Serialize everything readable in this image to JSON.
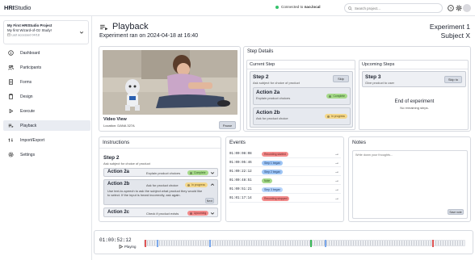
{
  "app": {
    "logo_bold": "HRI",
    "logo_rest": "Studio"
  },
  "topbar": {
    "connection_prefix": "Connected to ",
    "connection_host": "nao.local",
    "search_placeholder": "Search project...",
    "status_color": "#34c26b"
  },
  "project": {
    "name": "My First HRIStudio Project",
    "study": "My first Wizard-of-Oz Study!",
    "accessed": "Last accessed 04/18"
  },
  "sidebar": {
    "items": [
      {
        "label": "Dashboard",
        "icon": "info-icon"
      },
      {
        "label": "Participants",
        "icon": "users-icon"
      },
      {
        "label": "Forms",
        "icon": "document-icon"
      },
      {
        "label": "Design",
        "icon": "clipboard-icon"
      },
      {
        "label": "Execute",
        "icon": "play-icon"
      },
      {
        "label": "Playback",
        "icon": "playlist-icon",
        "active": true
      },
      {
        "label": "Import/Export",
        "icon": "swap-icon"
      },
      {
        "label": "Settings",
        "icon": "gear-icon"
      }
    ]
  },
  "header": {
    "title": "Playback",
    "subtitle": "Experiment ran on 2024-04-18 at 16:40",
    "experiment": "Experiment 1",
    "subject": "Subject X"
  },
  "video": {
    "title": "Video View",
    "location": "Location: DANA 327A",
    "pause_label": "Pause"
  },
  "step_details": {
    "title": "Step Details",
    "current": {
      "title": "Current Step",
      "step_name": "Step 2",
      "step_desc": "Ask subject for choice of product",
      "skip_label": "Skip",
      "actions": [
        {
          "name": "Action 2a",
          "desc": "Explain product choices",
          "status": "Complete"
        },
        {
          "name": "Action 2b",
          "desc": "Ask for product choice",
          "status": "In progress"
        }
      ]
    },
    "upcoming": {
      "title": "Upcoming Steps",
      "step_name": "Step 3",
      "step_desc": "Give product to user",
      "skip_to_label": "Skip to",
      "end_title": "End of experiment",
      "end_desc": "No remaining steps."
    }
  },
  "instructions": {
    "title": "Instructions",
    "step_name": "Step 2",
    "step_desc": "Ask subject for choice of product",
    "subs": [
      {
        "name": "Action 2a",
        "desc": "Explain product choices",
        "status": "Complete"
      },
      {
        "name": "Action 2b",
        "desc": "Ask for product choice",
        "status": "In progress",
        "detail": "Use text-to-speech to ask the subject what product they would like to select. If the input is heard incorrectly, ask again.",
        "next_label": "Next"
      },
      {
        "name": "Action 2c",
        "desc": "Check if product exists",
        "status": "Upcoming"
      }
    ]
  },
  "events": {
    "title": "Events",
    "rows": [
      {
        "time": "01:00:08:08",
        "label": "Recording started",
        "color": "red"
      },
      {
        "time": "01:00:05:46",
        "label": "Step 1 began",
        "color": "blue"
      },
      {
        "time": "01:00:22:12",
        "label": "Step 2 began",
        "color": "blue"
      },
      {
        "time": "01:00:48:51",
        "label": "Note",
        "color": "green"
      },
      {
        "time": "01:00:51:21",
        "label": "Step 3 began",
        "color": "blue"
      },
      {
        "time": "01:01:17:14",
        "label": "Recording stopped",
        "color": "red"
      }
    ]
  },
  "notes": {
    "title": "Notes",
    "placeholder": "Write down your thoughts...",
    "save_label": "Save note"
  },
  "timeline": {
    "time": "01:00:52:12",
    "state": "Playing"
  }
}
